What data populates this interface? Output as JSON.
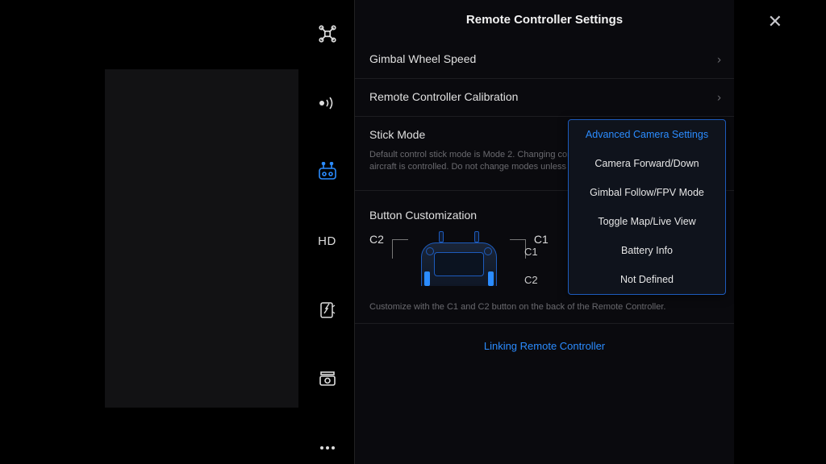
{
  "sidebar": {
    "hd_label": "HD"
  },
  "panel": {
    "title": "Remote Controller Settings",
    "close": "✕"
  },
  "rows": {
    "gimbal_speed": "Gimbal Wheel Speed",
    "rc_calibration": "Remote Controller Calibration",
    "stick_mode": "Stick Mode",
    "stick_desc": "Default control stick mode is Mode 2. Changing control modes alters the way the aircraft is controlled. Do not change modes unless you are familiar with the mode."
  },
  "button_custom": {
    "title": "Button Customization",
    "c1_label": "C1",
    "c2_label": "C2",
    "row_c1": "C1",
    "row_c2": "C2",
    "hint": "Customize with the C1 and C2 button on the back of the Remote Controller."
  },
  "link_rc": "Linking Remote Controller",
  "popup": {
    "items": [
      "Advanced Camera Settings",
      "Camera Forward/Down",
      "Gimbal Follow/FPV Mode",
      "Toggle Map/Live View",
      "Battery Info",
      "Not Defined"
    ]
  }
}
